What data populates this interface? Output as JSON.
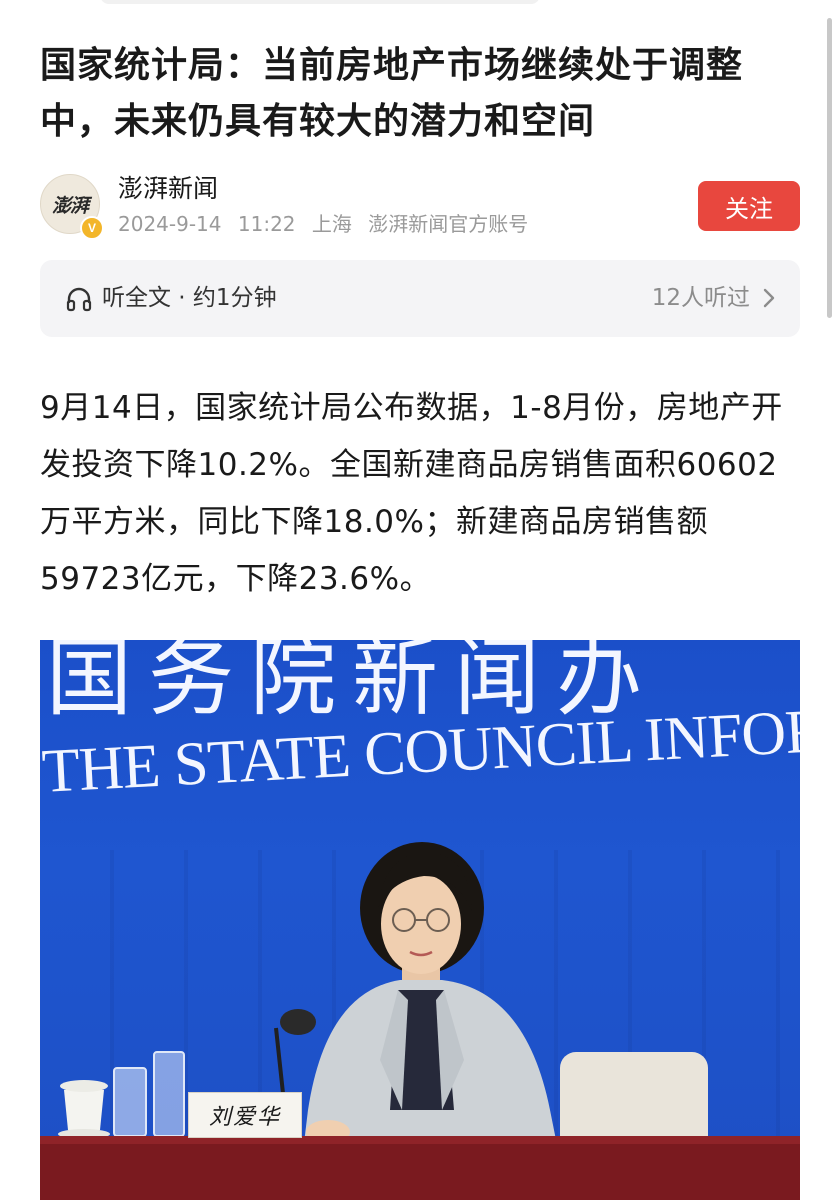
{
  "article": {
    "title": "国家统计局：当前房地产市场继续处于调整中，未来仍具有较大的潜力和空间"
  },
  "author": {
    "avatar_text": "澎湃",
    "name": "澎湃新闻",
    "date": "2024-9-14",
    "time": "11:22",
    "location": "上海",
    "account_type": "澎湃新闻官方账号",
    "verified_badge": "V",
    "follow_label": "关注"
  },
  "audio": {
    "label": "听全文 · 约1分钟",
    "listen_count": "12人听过"
  },
  "body": {
    "paragraph": "9月14日，国家统计局公布数据，1-8月份，房地产开发投资下降10.2%。全国新建商品房销售面积60602万平方米，同比下降18.0%；新建商品房销售额59723亿元，下降23.6%。"
  },
  "photo": {
    "backdrop_cn": "国务院新闻办",
    "backdrop_en": "THE STATE COUNCIL INFORMATION",
    "nameplate": "刘爱华"
  },
  "icons": {
    "headphone": "headphone-icon",
    "chevron": "chevron-right-icon",
    "verified": "verified-badge-icon"
  },
  "colors": {
    "follow_button": "#e8473e",
    "verified": "#f3b62a",
    "backdrop_blue": "#1d52cb"
  }
}
